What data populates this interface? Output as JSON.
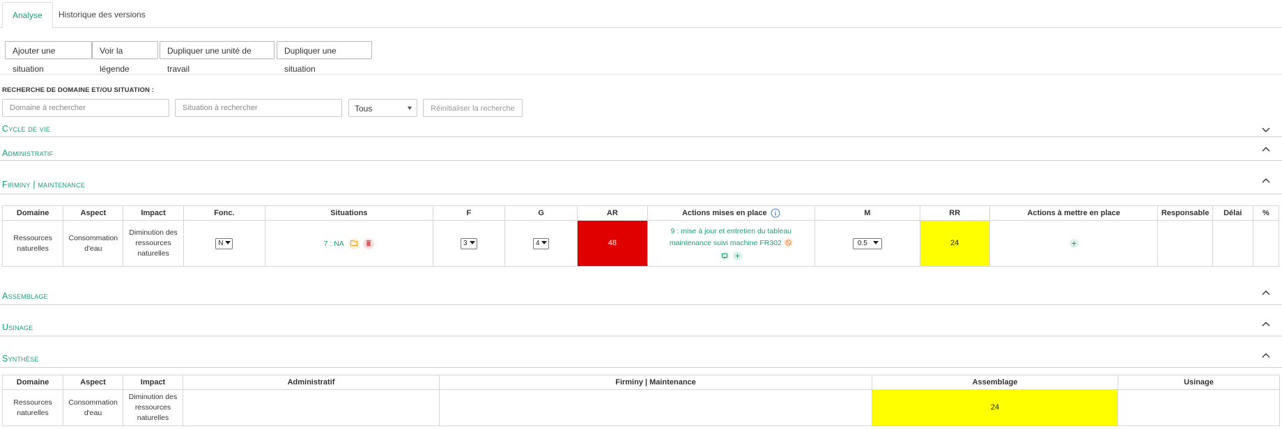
{
  "tabs": [
    {
      "label": "Analyse",
      "active": true
    },
    {
      "label": "Historique des versions",
      "active": false
    }
  ],
  "toolbar": {
    "add_situation": "Ajouter une situation",
    "legend": "Voir la légende",
    "duplicate_unit": "Dupliquer une unité de travail",
    "duplicate_situation": "Dupliquer une situation"
  },
  "search": {
    "label": "RECHERCHE DE DOMAINE ET/OU SITUATION :",
    "domain_placeholder": "Domaine à rechercher",
    "situation_placeholder": "Situation à rechercher",
    "filter_value": "Tous",
    "reset_label": "Réinitialiser la recherche"
  },
  "sections": {
    "cycle": {
      "title": "Cycle de vie",
      "expanded": false
    },
    "admin": {
      "title": "Administratif",
      "expanded": true
    },
    "firminy": {
      "title": "Firminy | maintenance",
      "expanded": true
    },
    "assemblage": {
      "title": "Assemblage",
      "expanded": true
    },
    "usinage": {
      "title": "Usinage",
      "expanded": true
    },
    "synthese": {
      "title": "Synthèse",
      "expanded": true
    }
  },
  "analysis_table": {
    "headers": {
      "domaine": "Domaine",
      "aspect": "Aspect",
      "impact": "Impact",
      "fonc": "Fonc.",
      "situations": "Situations",
      "f": "F",
      "g": "G",
      "ar": "AR",
      "actions_done": "Actions mises en place",
      "m": "M",
      "rr": "RR",
      "actions_todo": "Actions à mettre en place",
      "responsable": "Responsable",
      "delai": "Délai",
      "pct": "%"
    },
    "row": {
      "domaine": "Ressources naturelles",
      "aspect": "Consommation d'eau",
      "impact": "Diminution des ressources naturelles",
      "fonc": "N",
      "situation": "7 : NA",
      "f": "3",
      "g": "4",
      "ar": "48",
      "action_done": "9 : mise à jour et entretien du tableau maintenance suivi machine FR302",
      "m": "0.5",
      "rr": "24"
    },
    "colors": {
      "ar": "#e00000",
      "rr": "#ffff00"
    }
  },
  "synthese_table": {
    "headers": {
      "domaine": "Domaine",
      "aspect": "Aspect",
      "impact": "Impact",
      "administratif": "Administratif",
      "firminy": "Firminy | Maintenance",
      "assemblage": "Assemblage",
      "usinage": "Usinage"
    },
    "row": {
      "domaine": "Ressources naturelles",
      "aspect": "Consommation d'eau",
      "impact": "Diminution des ressources naturelles",
      "administratif": "",
      "firminy": "",
      "assemblage": "24",
      "usinage": ""
    }
  },
  "icons": {
    "folder": "folder-icon",
    "trash": "trash-icon",
    "info": "info-icon",
    "ban": "ban-icon",
    "screen": "screen-icon",
    "plus": "plus-icon",
    "chevron_up": "chevron-up-icon",
    "chevron_down": "chevron-down-icon"
  },
  "accent_color": "#1f9a7a"
}
